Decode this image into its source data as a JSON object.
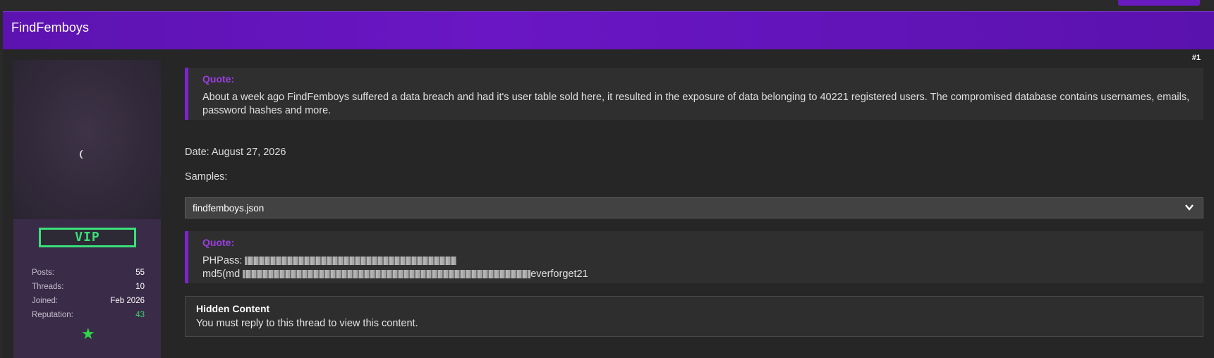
{
  "thread": {
    "title": "FindFemboys"
  },
  "user": {
    "badge": "VIP",
    "stats": [
      {
        "label": "Posts:",
        "value": "55"
      },
      {
        "label": "Threads:",
        "value": "10"
      },
      {
        "label": "Joined:",
        "value": "Feb 2026"
      },
      {
        "label": "Reputation:",
        "value": "43"
      }
    ],
    "reputation_icon": "star-icon",
    "colors": {
      "reputation": "#3fd06b",
      "badge": "#39e07a"
    }
  },
  "post": {
    "number": "#1",
    "quote1": {
      "label": "Quote:",
      "text": "About a week ago FindFemboys suffered a data breach and had it's user table sold here, it resulted in the exposure of data belonging to 40221 registered users. The compromised database contains usernames, emails, password hashes and more."
    },
    "date": "Date: August 27, 2026",
    "samples": "Samples:",
    "file_select": {
      "value": "findfemboys.json",
      "icon": "chevron-down-icon"
    },
    "quote2": {
      "label": "Quote:",
      "line1": "PHPass:",
      "line2_start": "md5(md",
      "line2_end": "everforget21"
    },
    "hidden": {
      "title": "Hidden Content",
      "text": "You must reply to this thread to view this content."
    }
  },
  "colors": {
    "accent": "#6a16c4",
    "quote_label": "#9b3ee3"
  }
}
